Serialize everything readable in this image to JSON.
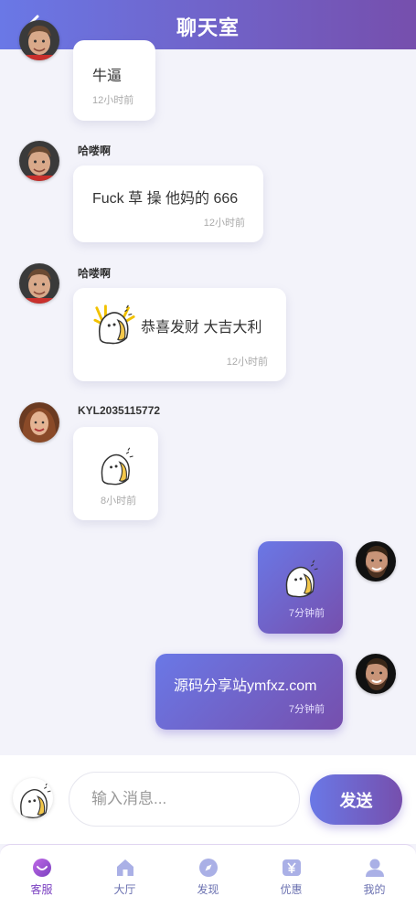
{
  "header": {
    "title": "聊天室"
  },
  "messages": [
    {
      "sender": "",
      "text": "牛逼",
      "time": "12小时前",
      "mine": false
    },
    {
      "sender": "哈喽啊",
      "text": "Fuck 草 操 他妈的 666",
      "time": "12小时前",
      "mine": false
    },
    {
      "sender": "哈喽啊",
      "text": "恭喜发财 大吉大利",
      "time": "12小时前",
      "mine": false,
      "sticker": "sticker-icon"
    },
    {
      "sender": "KYL2035115772",
      "text": "",
      "time": "8小时前",
      "mine": false,
      "sticker": "sticker-icon"
    },
    {
      "sender": "",
      "text": "",
      "time": "7分钟前",
      "mine": true,
      "sticker": "sticker-icon"
    },
    {
      "sender": "",
      "text": "源码分享站ymfxz.com",
      "time": "7分钟前",
      "mine": true
    }
  ],
  "composer": {
    "placeholder": "输入消息...",
    "send_label": "发送"
  },
  "tabs": [
    {
      "label": "客服",
      "icon": "service-icon",
      "active": true
    },
    {
      "label": "大厅",
      "icon": "home-icon",
      "active": false
    },
    {
      "label": "发现",
      "icon": "compass-icon",
      "active": false
    },
    {
      "label": "优惠",
      "icon": "yen-icon",
      "active": false
    },
    {
      "label": "我的",
      "icon": "user-icon",
      "active": false
    }
  ],
  "colors": {
    "accent_start": "#6a78e6",
    "accent_end": "#764fad",
    "active_tab": "#7a3fc0"
  }
}
